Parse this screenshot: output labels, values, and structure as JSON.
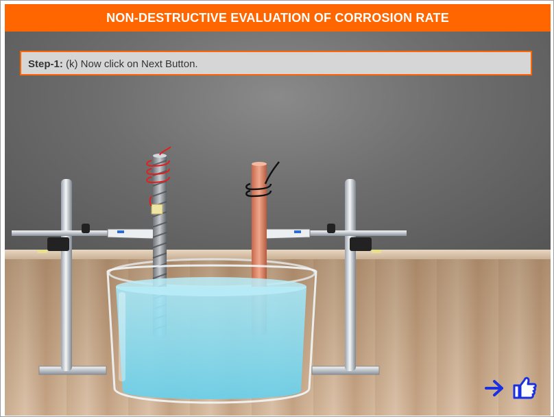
{
  "header": {
    "title": "NON-DESTRUCTIVE EVALUATION OF CORROSION RATE"
  },
  "instruction": {
    "step_label": "Step-1:",
    "text": "(k) Now click on Next Button."
  },
  "icons": {
    "next": "arrow-right-icon",
    "pointer": "hand-pointer-icon"
  },
  "colors": {
    "accent": "#ff6600",
    "nav_blue": "#1a2fe0",
    "water": "#8fdcf0"
  }
}
